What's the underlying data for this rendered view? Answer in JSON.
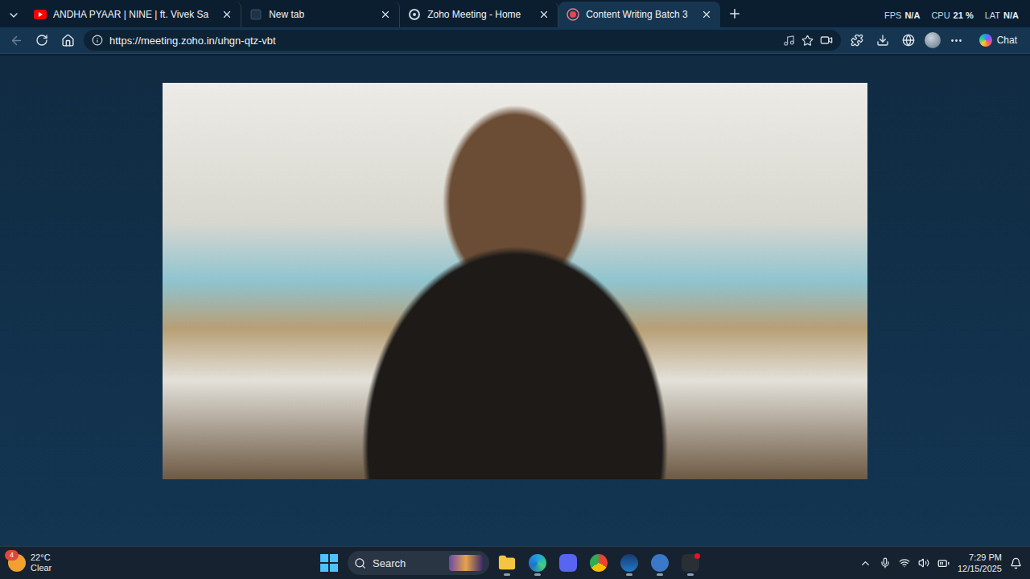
{
  "tabs": [
    {
      "title": "ANDHA PYAAR | NINE | ft. Vivek Sa",
      "selected": false,
      "kind": "youtube"
    },
    {
      "title": "New tab",
      "selected": false,
      "kind": "blank"
    },
    {
      "title": "Zoho Meeting - Home",
      "selected": false,
      "kind": "zoho"
    },
    {
      "title": "Content Writing Batch 3",
      "selected": true,
      "kind": "recording"
    }
  ],
  "perf": [
    {
      "label": "FPS",
      "value": "N/A"
    },
    {
      "label": "CPU",
      "value": "21 %"
    },
    {
      "label": "LAT",
      "value": "N/A"
    }
  ],
  "address_bar": {
    "url": "https://meeting.zoho.in/uhgn-qtz-vbt"
  },
  "copilot": {
    "label": "Chat"
  },
  "weather": {
    "badge": "4",
    "temperature": "22°C",
    "condition": "Clear"
  },
  "taskbar": {
    "search_placeholder": "Search",
    "apps": [
      {
        "kind": "file-explorer",
        "running": true,
        "notification": false
      },
      {
        "kind": "edge",
        "running": true,
        "notification": false
      },
      {
        "kind": "discord",
        "running": false,
        "notification": false
      },
      {
        "kind": "chrome",
        "running": false,
        "notification": false
      },
      {
        "kind": "steam",
        "running": true,
        "notification": false
      },
      {
        "kind": "qbittorrent",
        "running": true,
        "notification": false
      },
      {
        "kind": "recorder",
        "running": true,
        "notification": true
      }
    ]
  },
  "clock": {
    "time": "7:29 PM",
    "date": "12/15/2025"
  }
}
